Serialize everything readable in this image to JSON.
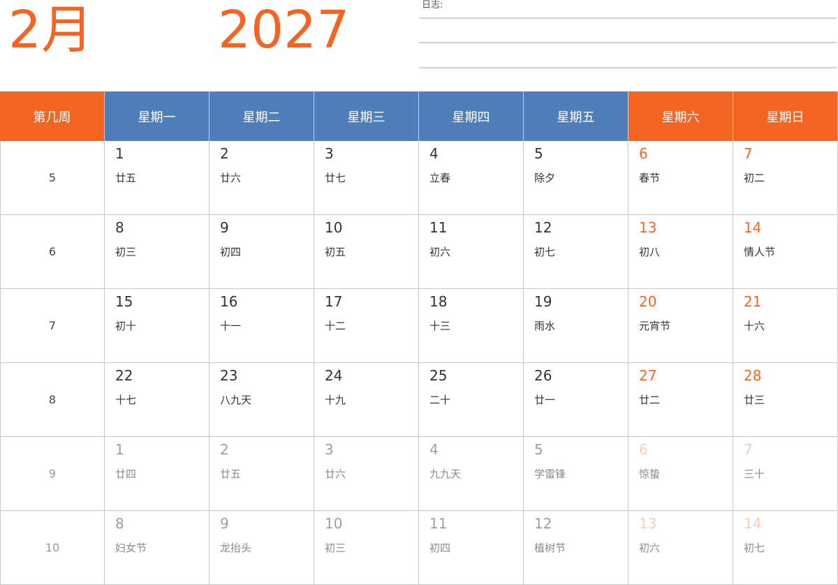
{
  "header": {
    "month": "2月",
    "year": "2027",
    "notes_label": "日志:"
  },
  "colors": {
    "accent_orange": "#f26522",
    "weekday_blue": "#4e7fba",
    "faded_text": "#9e9e9e",
    "faded_weekend": "#f6cbb8"
  },
  "columns": [
    {
      "label": "第几周",
      "color": "orange"
    },
    {
      "label": "星期一",
      "color": "blue"
    },
    {
      "label": "星期二",
      "color": "blue"
    },
    {
      "label": "星期三",
      "color": "blue"
    },
    {
      "label": "星期四",
      "color": "blue"
    },
    {
      "label": "星期五",
      "color": "blue"
    },
    {
      "label": "星期六",
      "color": "orange"
    },
    {
      "label": "星期日",
      "color": "orange"
    }
  ],
  "weeks": [
    {
      "week": "5",
      "days": [
        {
          "day": "1",
          "lunar": "廿五"
        },
        {
          "day": "2",
          "lunar": "廿六"
        },
        {
          "day": "3",
          "lunar": "廿七"
        },
        {
          "day": "4",
          "lunar": "立春"
        },
        {
          "day": "5",
          "lunar": "除夕"
        },
        {
          "day": "6",
          "lunar": "春节"
        },
        {
          "day": "7",
          "lunar": "初二"
        }
      ]
    },
    {
      "week": "6",
      "days": [
        {
          "day": "8",
          "lunar": "初三"
        },
        {
          "day": "9",
          "lunar": "初四"
        },
        {
          "day": "10",
          "lunar": "初五"
        },
        {
          "day": "11",
          "lunar": "初六"
        },
        {
          "day": "12",
          "lunar": "初七"
        },
        {
          "day": "13",
          "lunar": "初八"
        },
        {
          "day": "14",
          "lunar": "情人节"
        }
      ]
    },
    {
      "week": "7",
      "days": [
        {
          "day": "15",
          "lunar": "初十"
        },
        {
          "day": "16",
          "lunar": "十一"
        },
        {
          "day": "17",
          "lunar": "十二"
        },
        {
          "day": "18",
          "lunar": "十三"
        },
        {
          "day": "19",
          "lunar": "雨水"
        },
        {
          "day": "20",
          "lunar": "元宵节"
        },
        {
          "day": "21",
          "lunar": "十六"
        }
      ]
    },
    {
      "week": "8",
      "days": [
        {
          "day": "22",
          "lunar": "十七"
        },
        {
          "day": "23",
          "lunar": "八九天"
        },
        {
          "day": "24",
          "lunar": "十九"
        },
        {
          "day": "25",
          "lunar": "二十"
        },
        {
          "day": "26",
          "lunar": "廿一"
        },
        {
          "day": "27",
          "lunar": "廿二"
        },
        {
          "day": "28",
          "lunar": "廿三"
        }
      ]
    },
    {
      "week": "9",
      "faded": true,
      "days": [
        {
          "day": "1",
          "lunar": "廿四"
        },
        {
          "day": "2",
          "lunar": "廿五"
        },
        {
          "day": "3",
          "lunar": "廿六"
        },
        {
          "day": "4",
          "lunar": "九九天"
        },
        {
          "day": "5",
          "lunar": "学雷锋"
        },
        {
          "day": "6",
          "lunar": "惊蛰"
        },
        {
          "day": "7",
          "lunar": "三十"
        }
      ]
    },
    {
      "week": "10",
      "faded": true,
      "days": [
        {
          "day": "8",
          "lunar": "妇女节"
        },
        {
          "day": "9",
          "lunar": "龙抬头"
        },
        {
          "day": "10",
          "lunar": "初三"
        },
        {
          "day": "11",
          "lunar": "初四"
        },
        {
          "day": "12",
          "lunar": "植树节"
        },
        {
          "day": "13",
          "lunar": "初六"
        },
        {
          "day": "14",
          "lunar": "初七"
        }
      ]
    }
  ]
}
